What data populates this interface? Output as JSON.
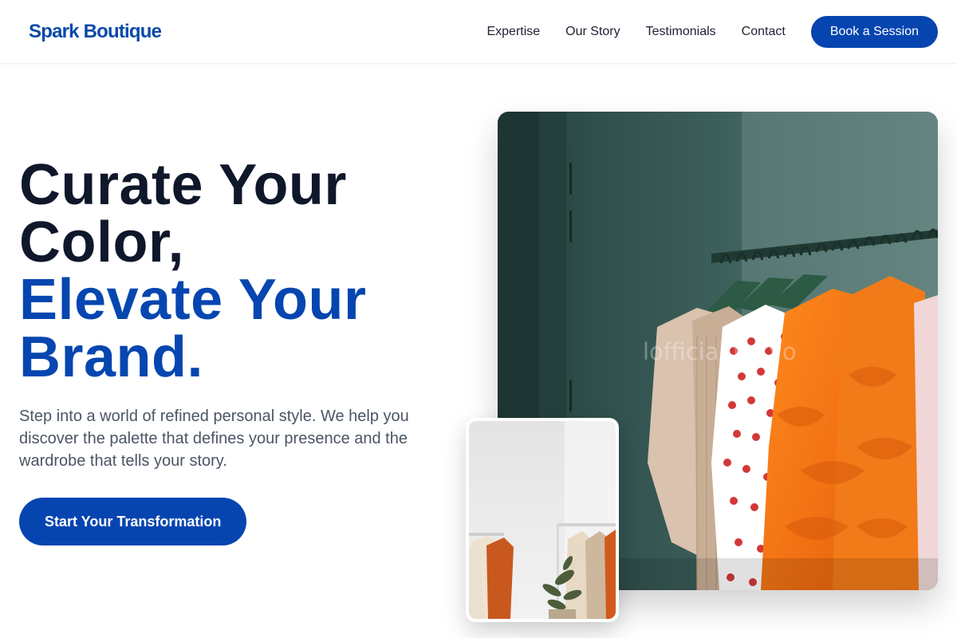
{
  "header": {
    "logo": "Spark Boutique",
    "nav": [
      "Expertise",
      "Our Story",
      "Testimonials",
      "Contact"
    ],
    "cta": "Book a Session"
  },
  "hero": {
    "title_line1": "Curate Your",
    "title_line2": "Color,",
    "title_accent_line1": "Elevate Your",
    "title_accent_line2": "Brand.",
    "subtitle": "Step into a world of refined personal style. We help you discover the palette that defines your presence and the wardrobe that tells your story.",
    "cta": "Start Your Transformation"
  },
  "images": {
    "main_watermark": "lofficial.tokyo"
  },
  "colors": {
    "brand_blue": "#0645b0",
    "title_dark": "#0f172a",
    "body_gray": "#4b5565"
  }
}
